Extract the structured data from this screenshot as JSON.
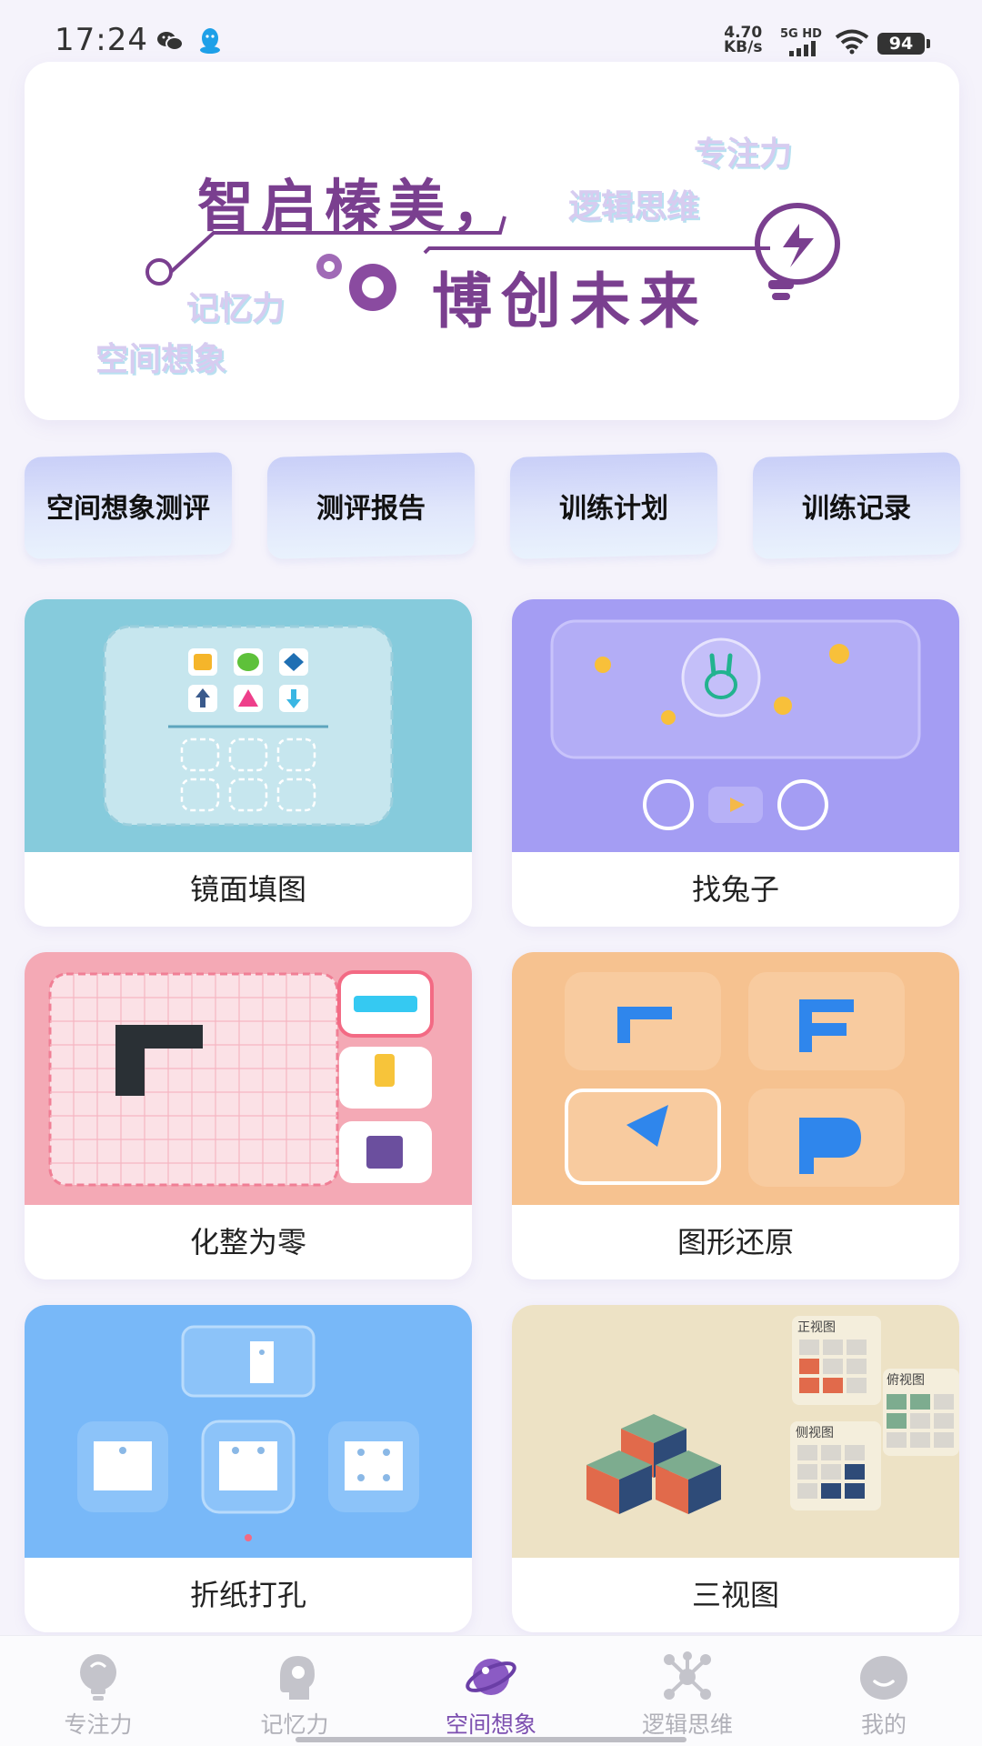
{
  "status_bar": {
    "time": "17:24",
    "net_speed_value": "4.70",
    "net_speed_unit": "KB/s",
    "net_type": "5G HD",
    "battery": "94",
    "icons": [
      "wechat-icon",
      "qq-icon",
      "signal-icon",
      "wifi-icon",
      "battery-icon"
    ]
  },
  "banner": {
    "slogan_line1": "智启榛美，",
    "slogan_line2": "博创未来",
    "tags": {
      "focus": "专注力",
      "logic": "逻辑思维",
      "memory": "记忆力",
      "space": "空间想象"
    }
  },
  "quick_actions": [
    {
      "label": "空间想象测评"
    },
    {
      "label": "测评报告"
    },
    {
      "label": "训练计划"
    },
    {
      "label": "训练记录"
    }
  ],
  "games": [
    {
      "label": "镜面填图",
      "color": "#86cbdc"
    },
    {
      "label": "找兔子",
      "color": "#a49df3"
    },
    {
      "label": "化整为零",
      "color": "#f4a9b5"
    },
    {
      "label": "图形还原",
      "color": "#f6c290"
    },
    {
      "label": "折纸打孔",
      "color": "#78b8f8"
    },
    {
      "label": "三视图",
      "color": "#ede2c5"
    }
  ],
  "three_view_labels": {
    "front": "正视图",
    "top": "俯视图",
    "side": "侧视图"
  },
  "bottom_nav": {
    "active_color": "#7c4fb0",
    "items": [
      {
        "label": "专注力",
        "icon": "bulb-icon"
      },
      {
        "label": "记忆力",
        "icon": "head-icon"
      },
      {
        "label": "空间想象",
        "icon": "planet-icon"
      },
      {
        "label": "逻辑思维",
        "icon": "network-icon"
      },
      {
        "label": "我的",
        "icon": "face-icon"
      }
    ]
  }
}
